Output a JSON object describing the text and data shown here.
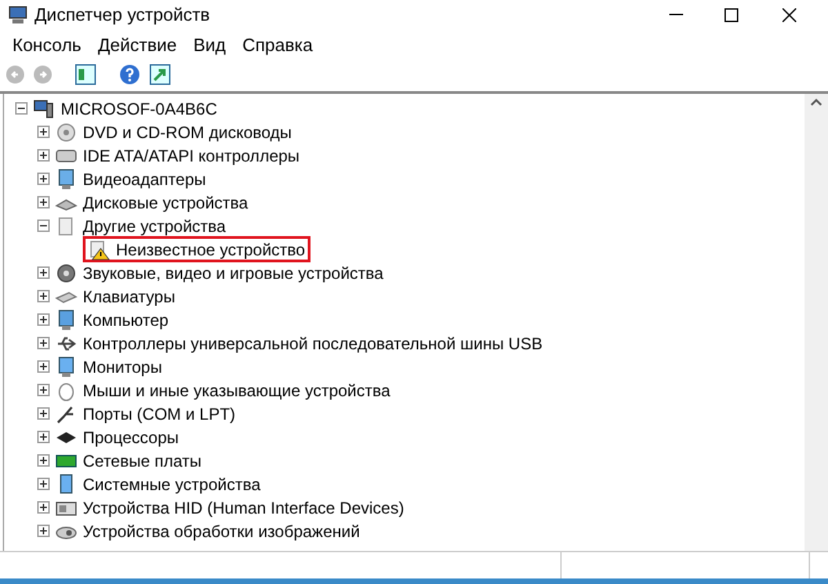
{
  "window": {
    "title": "Диспетчер устройств"
  },
  "menu": [
    "Консоль",
    "Действие",
    "Вид",
    "Справка"
  ],
  "tree": {
    "label": "MICROSOF-0A4B6C",
    "expanded": true,
    "children": [
      {
        "label": "DVD и CD-ROM дисководы",
        "expanded": false
      },
      {
        "label": "IDE ATA/ATAPI контроллеры",
        "expanded": false
      },
      {
        "label": "Видеоадаптеры",
        "expanded": false
      },
      {
        "label": "Дисковые устройства",
        "expanded": false
      },
      {
        "label": "Другие устройства",
        "expanded": true,
        "children": [
          {
            "label": "Неизвестное устройство",
            "highlighted": true,
            "warning": true
          }
        ]
      },
      {
        "label": "Звуковые, видео и игровые устройства",
        "expanded": false
      },
      {
        "label": "Клавиатуры",
        "expanded": false
      },
      {
        "label": "Компьютер",
        "expanded": false
      },
      {
        "label": "Контроллеры универсальной последовательной шины USB",
        "expanded": false
      },
      {
        "label": "Мониторы",
        "expanded": false
      },
      {
        "label": "Мыши и иные указывающие устройства",
        "expanded": false
      },
      {
        "label": "Порты (COM и LPT)",
        "expanded": false
      },
      {
        "label": "Процессоры",
        "expanded": false
      },
      {
        "label": "Сетевые платы",
        "expanded": false
      },
      {
        "label": "Системные устройства",
        "expanded": false
      },
      {
        "label": "Устройства HID (Human Interface Devices)",
        "expanded": false
      },
      {
        "label": "Устройства обработки изображений",
        "expanded": false
      }
    ]
  }
}
